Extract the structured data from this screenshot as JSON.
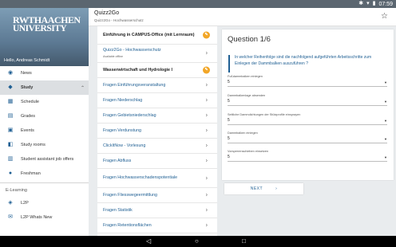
{
  "status_bar": {
    "time": "07:59",
    "icons": [
      "bluetooth-icon",
      "wifi-icon",
      "battery-icon"
    ]
  },
  "drawer": {
    "logo_line1": "RWTHAACHEN",
    "logo_line2": "UNIVERSITY",
    "user_name": "Hello, Andreas Schmidt",
    "items": [
      {
        "label": "News",
        "icon": "rss-icon"
      },
      {
        "label": "Study",
        "icon": "graduation-cap-icon"
      },
      {
        "label": "Schedule",
        "icon": "calendar-icon"
      },
      {
        "label": "Grades",
        "icon": "grades-icon"
      },
      {
        "label": "Events",
        "icon": "event-icon"
      },
      {
        "label": "Study rooms",
        "icon": "room-icon"
      },
      {
        "label": "Student assistant job offers",
        "icon": "job-icon"
      },
      {
        "label": "Freshman",
        "icon": "freshman-icon"
      },
      {
        "label": "L2P",
        "icon": "l2p-icon"
      },
      {
        "label": "L2P Whats New",
        "icon": "whats-new-icon"
      }
    ],
    "section_caption": "E-Learning"
  },
  "appbar": {
    "title": "Quizz2Go",
    "subtitle": "Quizz2Go - Hochwasserschutz"
  },
  "list": {
    "rows": [
      {
        "label": "Einführung in CAMPUS-Office (mit Lernraum)",
        "type": "header"
      },
      {
        "label": "Quizz2Go - Hochwasserschutz",
        "note": "Available offline",
        "type": "item"
      },
      {
        "label": "Wasserwirtschaft und Hydrologie I",
        "type": "header"
      },
      {
        "label": "Fragen Einführungsveranstaltung",
        "type": "item"
      },
      {
        "label": "Fragen Niederschlag",
        "type": "item"
      },
      {
        "label": "Fragen Gebietsniederschlag",
        "type": "item"
      },
      {
        "label": "Fragen Verdunstung",
        "type": "item"
      },
      {
        "label": "ClickItNow - Vorlesung",
        "type": "item"
      },
      {
        "label": "Fragen Abfluss",
        "type": "item"
      },
      {
        "label": "Fragen Hochwasserschadenspotentiale",
        "type": "item"
      },
      {
        "label": "Fragen Fliesswegeermittlung",
        "type": "item"
      },
      {
        "label": "Fragen Statistik",
        "type": "item"
      },
      {
        "label": "Fragen Retentionsflächen",
        "type": "item"
      }
    ]
  },
  "question": {
    "title": "Question 1/6",
    "text": "In welcher Reihenfolge sind die nachfolgend aufgeführten Arbeitsschritte zum Einlegen der Dammbalken auszuführen ?",
    "fields": [
      {
        "label": "Fußdammbalken einlegen",
        "value": "5"
      },
      {
        "label": "Dammbalkenlage absenden",
        "value": "5"
      },
      {
        "label": "Seitliche Dammdichtungen der Stützprofile einsprayen",
        "value": "5"
      },
      {
        "label": "Dammbalken einlegen",
        "value": "5"
      },
      {
        "label": "Vorsperrenschieben einsetzen",
        "value": "5"
      }
    ]
  },
  "next_label": "NEXT",
  "accent_color": "#1f5f93",
  "badge_color": "#f2a627"
}
